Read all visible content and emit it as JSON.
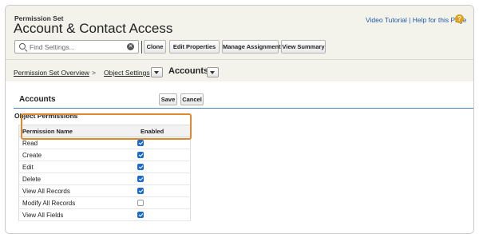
{
  "header": {
    "breadcrumb_label": "Permission Set",
    "title": "Account & Contact Access",
    "help_links": "Video Tutorial | Help for this Page",
    "help_icon": "question-circle-icon",
    "help_color": "#e1a11b"
  },
  "toolbar": {
    "search_placeholder": "Find Settings...",
    "clone_label": "Clone",
    "edit_properties_label": "Edit Properties",
    "manage_assignments_label": "Manage Assignments",
    "view_summary_label": "View Summary"
  },
  "breadcrumb": {
    "overview": "Permission Set Overview",
    "separator": ">",
    "object_settings": "Object Settings",
    "current": "Accounts"
  },
  "section": {
    "title": "Accounts",
    "save_label": "Save",
    "cancel_label": "Cancel",
    "subsection": "Object Permissions",
    "accent_color": "#4f81bd",
    "highlight_color": "#dc8a2d"
  },
  "table": {
    "columns": [
      "Permission Name",
      "Enabled"
    ],
    "rows": [
      {
        "name": "Read",
        "enabled": true
      },
      {
        "name": "Create",
        "enabled": true
      },
      {
        "name": "Edit",
        "enabled": true
      },
      {
        "name": "Delete",
        "enabled": true
      },
      {
        "name": "View All Records",
        "enabled": true
      },
      {
        "name": "Modify All Records",
        "enabled": false
      },
      {
        "name": "View All Fields",
        "enabled": true
      }
    ]
  }
}
